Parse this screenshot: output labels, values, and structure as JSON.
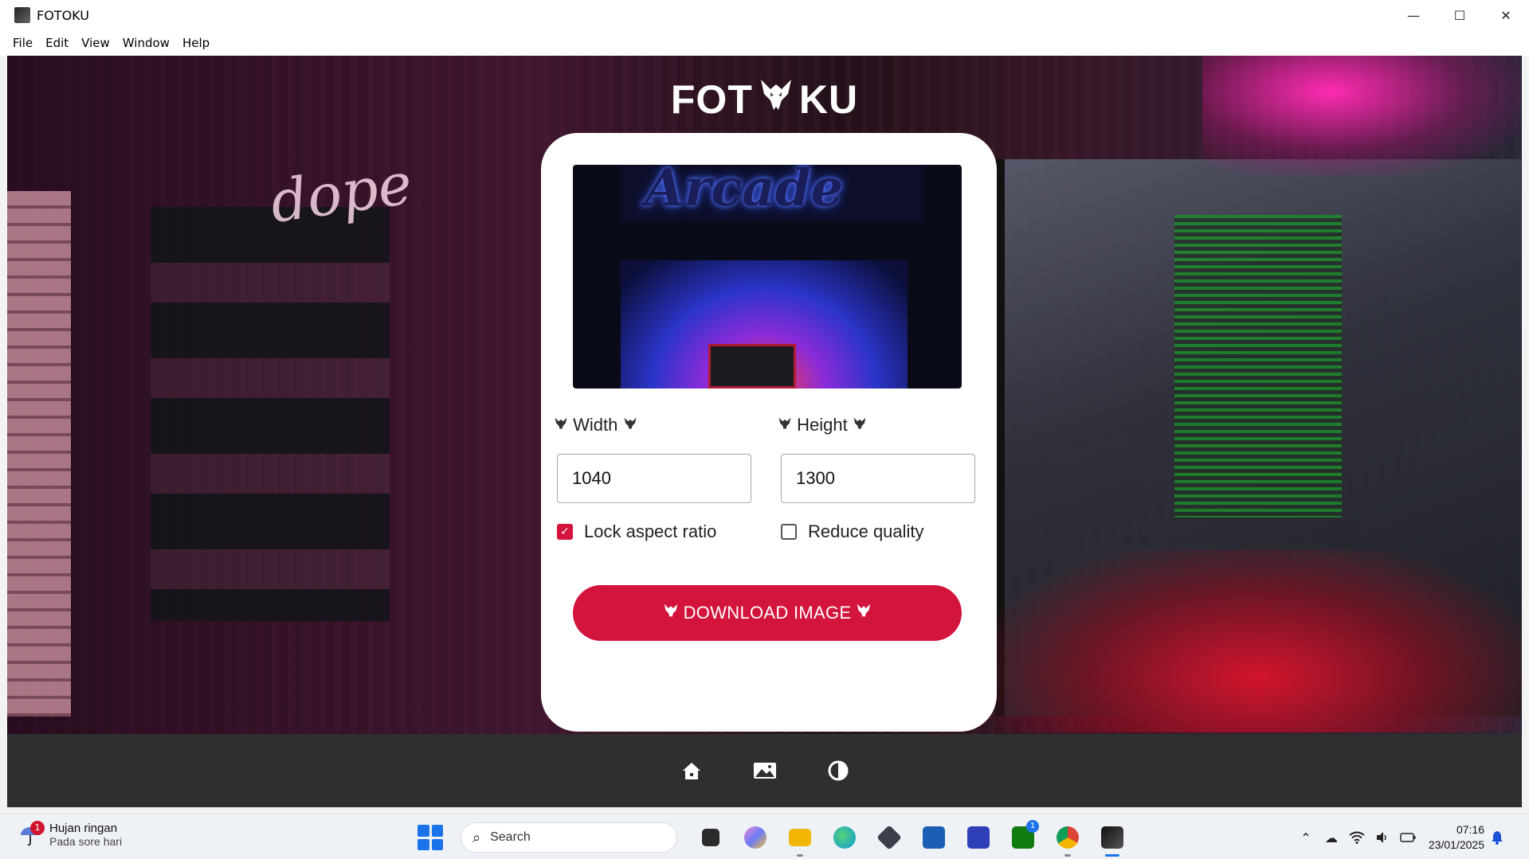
{
  "window": {
    "title": "FOTOKU",
    "controls": {
      "minimize": "—",
      "maximize": "☐",
      "close": "✕"
    }
  },
  "menu": [
    "File",
    "Edit",
    "View",
    "Window",
    "Help"
  ],
  "app": {
    "logo_left": "FOT",
    "logo_right": "KU",
    "preview_sign": "Arcade",
    "width_label": "Width",
    "height_label": "Height",
    "width_value": "1040",
    "height_value": "1300",
    "lock_aspect_label": "Lock aspect ratio",
    "lock_aspect_checked": true,
    "reduce_quality_label": "Reduce quality",
    "reduce_quality_checked": false,
    "download_label": "DOWNLOAD IMAGE",
    "accent_color": "#d3143d"
  },
  "bottom_nav": [
    {
      "name": "home-icon"
    },
    {
      "name": "gallery-icon"
    },
    {
      "name": "contrast-icon"
    }
  ],
  "taskbar": {
    "weather": {
      "badge": "1",
      "title": "Hujan ringan",
      "subtitle": "Pada sore hari"
    },
    "search_placeholder": "Search",
    "apps": [
      {
        "name": "task-view-icon",
        "color": "#2b2b2b"
      },
      {
        "name": "copilot-icon",
        "color": "#8a5cf6"
      },
      {
        "name": "file-explorer-icon",
        "color": "#f2b705"
      },
      {
        "name": "edge-icon",
        "color": "#0f9bd7"
      },
      {
        "name": "app-cube-icon",
        "color": "#3b3f4a"
      },
      {
        "name": "microsoft-store-icon",
        "color": "#1a5fb4"
      },
      {
        "name": "app-blue-icon",
        "color": "#2f3fb8"
      },
      {
        "name": "xbox-icon",
        "color": "#107c10",
        "badge": "1"
      },
      {
        "name": "chrome-icon",
        "color": "#db4437"
      },
      {
        "name": "fotoku-taskbar-icon",
        "color": "#333333"
      }
    ],
    "clock_time": "07:16",
    "clock_date": "23/01/2025"
  }
}
